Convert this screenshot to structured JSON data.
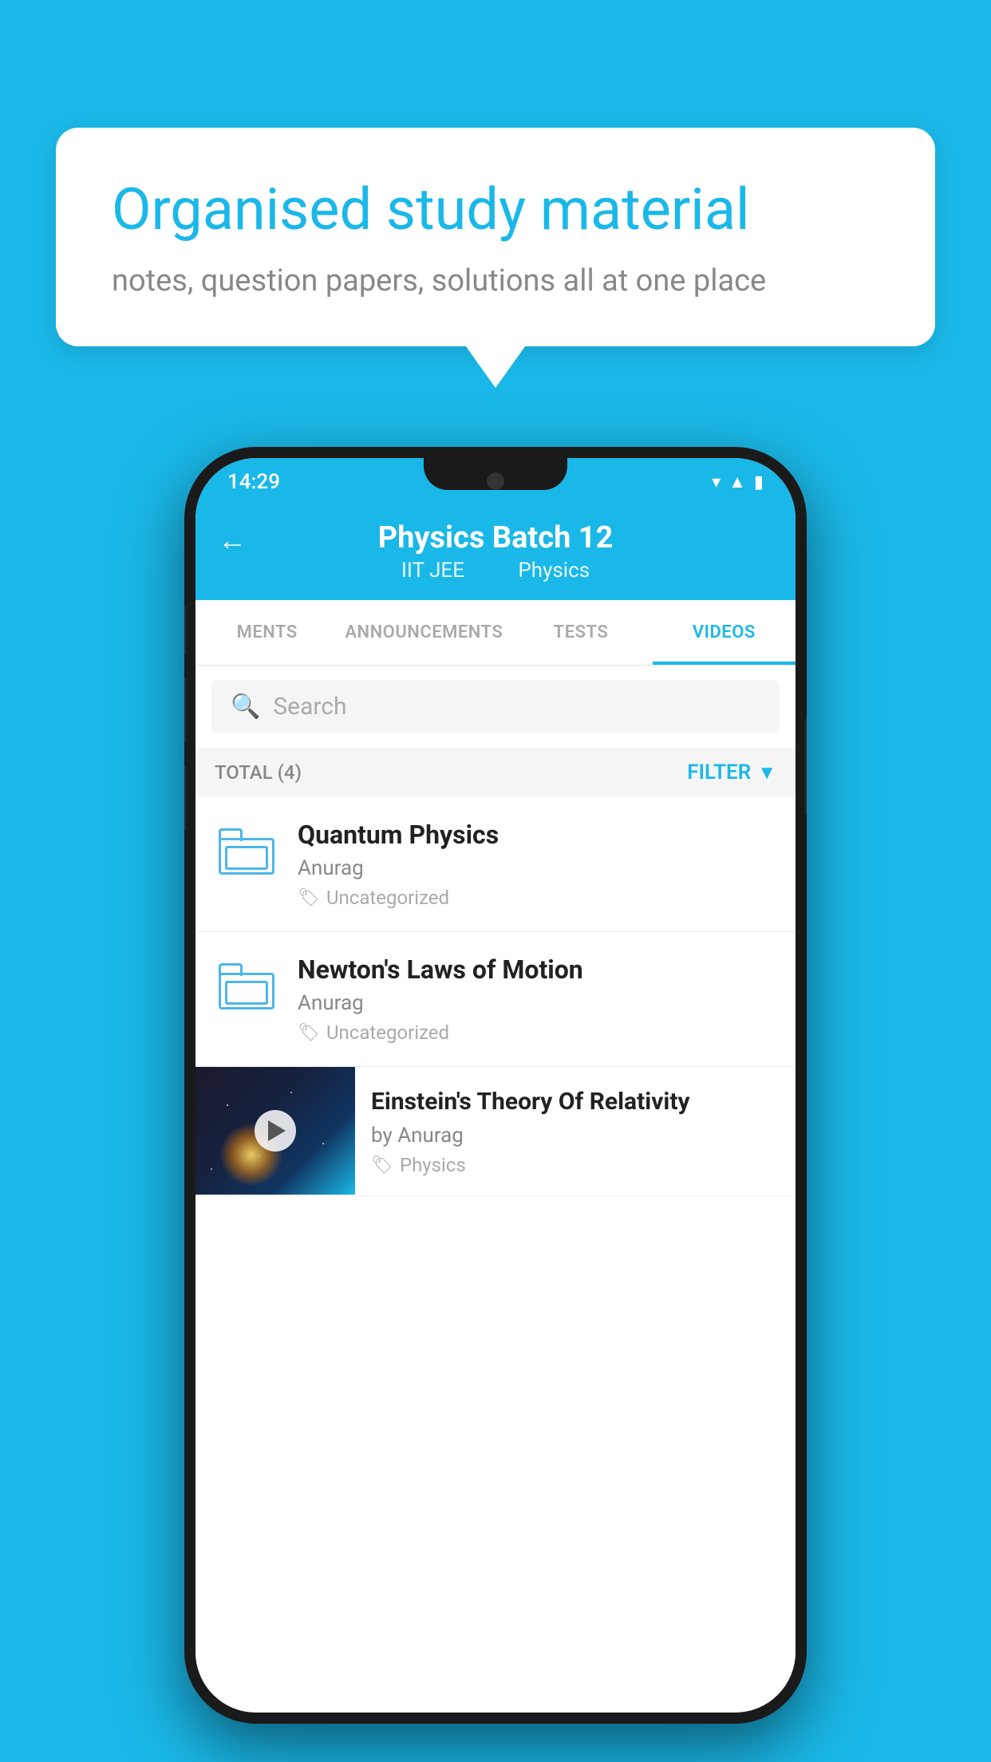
{
  "background_color": "#1ab8e8",
  "bubble": {
    "title": "Organised study material",
    "subtitle": "notes, question papers, solutions all at one place"
  },
  "phone": {
    "status_bar": {
      "time": "14:29"
    },
    "header": {
      "back_label": "←",
      "title": "Physics Batch 12",
      "subtitle_part1": "IIT JEE",
      "subtitle_part2": "Physics"
    },
    "tabs": [
      {
        "label": "MENTS",
        "active": false
      },
      {
        "label": "ANNOUNCEMENTS",
        "active": false
      },
      {
        "label": "TESTS",
        "active": false
      },
      {
        "label": "VIDEOS",
        "active": true
      }
    ],
    "search": {
      "placeholder": "Search"
    },
    "filter": {
      "total_label": "TOTAL (4)",
      "filter_label": "FILTER"
    },
    "videos": [
      {
        "title": "Quantum Physics",
        "author": "Anurag",
        "tag": "Uncategorized",
        "type": "folder"
      },
      {
        "title": "Newton's Laws of Motion",
        "author": "Anurag",
        "tag": "Uncategorized",
        "type": "folder"
      },
      {
        "title": "Einstein's Theory Of Relativity",
        "author": "by Anurag",
        "tag": "Physics",
        "type": "video"
      }
    ]
  }
}
